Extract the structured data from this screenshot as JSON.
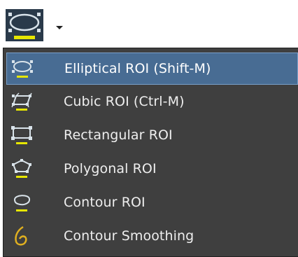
{
  "toolbar": {
    "button_icon": "elliptical-roi-icon",
    "dropdown_icon": "dropdown-arrow-icon"
  },
  "menu": {
    "items": [
      {
        "label": "Elliptical ROI (Shift-M)",
        "icon": "elliptical-roi-icon",
        "selected": true
      },
      {
        "label": "Cubic ROI (Ctrl-M)",
        "icon": "cubic-roi-icon",
        "selected": false
      },
      {
        "label": "Rectangular ROI",
        "icon": "rectangular-roi-icon",
        "selected": false
      },
      {
        "label": "Polygonal ROI",
        "icon": "polygonal-roi-icon",
        "selected": false
      },
      {
        "label": "Contour ROI",
        "icon": "contour-roi-icon",
        "selected": false
      },
      {
        "label": "Contour Smoothing",
        "icon": "contour-smoothing-icon",
        "selected": false
      }
    ]
  },
  "colors": {
    "menu_background": "#3f3f3f",
    "selection_background": "#486c93",
    "selection_border": "#7aa0c8",
    "icon_outline": "#d9e3ea",
    "icon_bar": "#e6e600",
    "smoothing_icon": "#e0b020"
  }
}
